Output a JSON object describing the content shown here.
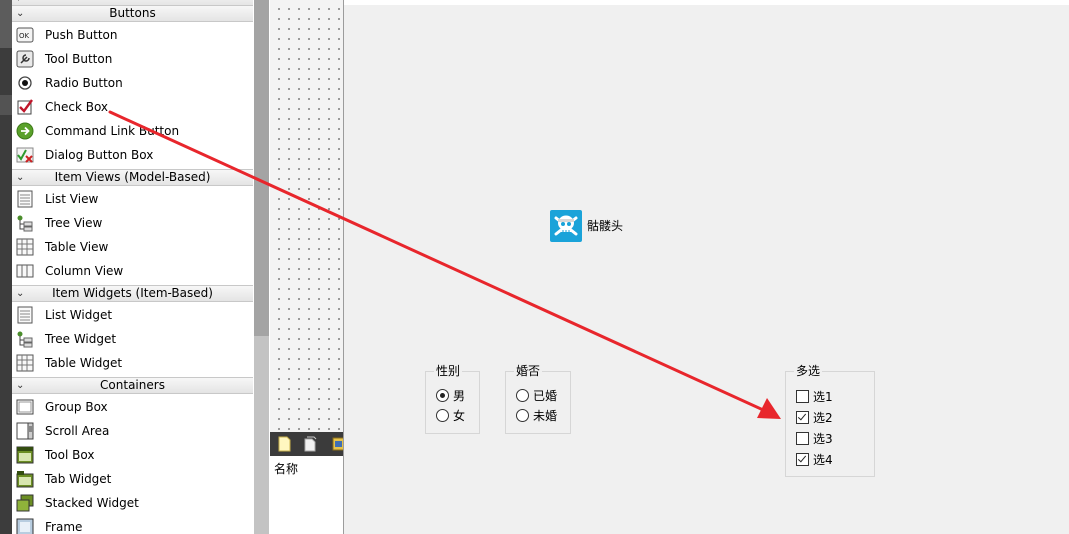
{
  "widget_box": {
    "categories": [
      {
        "label": "Buttons",
        "items": [
          {
            "label": "Push Button",
            "icon": "push-button-icon"
          },
          {
            "label": "Tool Button",
            "icon": "tool-button-icon"
          },
          {
            "label": "Radio Button",
            "icon": "radio-button-icon"
          },
          {
            "label": "Check Box",
            "icon": "check-box-icon"
          },
          {
            "label": "Command Link Button",
            "icon": "command-link-icon"
          },
          {
            "label": "Dialog Button Box",
            "icon": "dialog-button-box-icon"
          }
        ]
      },
      {
        "label": "Item Views (Model-Based)",
        "items": [
          {
            "label": "List View",
            "icon": "list-view-icon"
          },
          {
            "label": "Tree View",
            "icon": "tree-view-icon"
          },
          {
            "label": "Table View",
            "icon": "table-view-icon"
          },
          {
            "label": "Column View",
            "icon": "column-view-icon"
          }
        ]
      },
      {
        "label": "Item Widgets (Item-Based)",
        "items": [
          {
            "label": "List Widget",
            "icon": "list-widget-icon"
          },
          {
            "label": "Tree Widget",
            "icon": "tree-widget-icon"
          },
          {
            "label": "Table Widget",
            "icon": "table-widget-icon"
          }
        ]
      },
      {
        "label": "Containers",
        "items": [
          {
            "label": "Group Box",
            "icon": "group-box-icon"
          },
          {
            "label": "Scroll Area",
            "icon": "scroll-area-icon"
          },
          {
            "label": "Tool Box",
            "icon": "tool-box-icon"
          },
          {
            "label": "Tab Widget",
            "icon": "tab-widget-icon"
          },
          {
            "label": "Stacked Widget",
            "icon": "stacked-widget-icon"
          },
          {
            "label": "Frame",
            "icon": "frame-icon"
          }
        ]
      }
    ]
  },
  "object_panel": {
    "header": "名称"
  },
  "form": {
    "skull_label": "骷髅头",
    "gender_group": {
      "title": "性别",
      "options": [
        {
          "label": "男",
          "checked": true
        },
        {
          "label": "女",
          "checked": false
        }
      ]
    },
    "marriage_group": {
      "title": "婚否",
      "options": [
        {
          "label": "已婚",
          "checked": false
        },
        {
          "label": "未婚",
          "checked": false
        }
      ]
    },
    "multi_group": {
      "title": "多选",
      "options": [
        {
          "label": "选1",
          "checked": false
        },
        {
          "label": "选2",
          "checked": true
        },
        {
          "label": "选3",
          "checked": false
        },
        {
          "label": "选4",
          "checked": true
        }
      ]
    }
  },
  "colors": {
    "arrow": "#e8262c",
    "form_bg": "#f0f0f0",
    "dark_strip": "#3b3b3b"
  }
}
